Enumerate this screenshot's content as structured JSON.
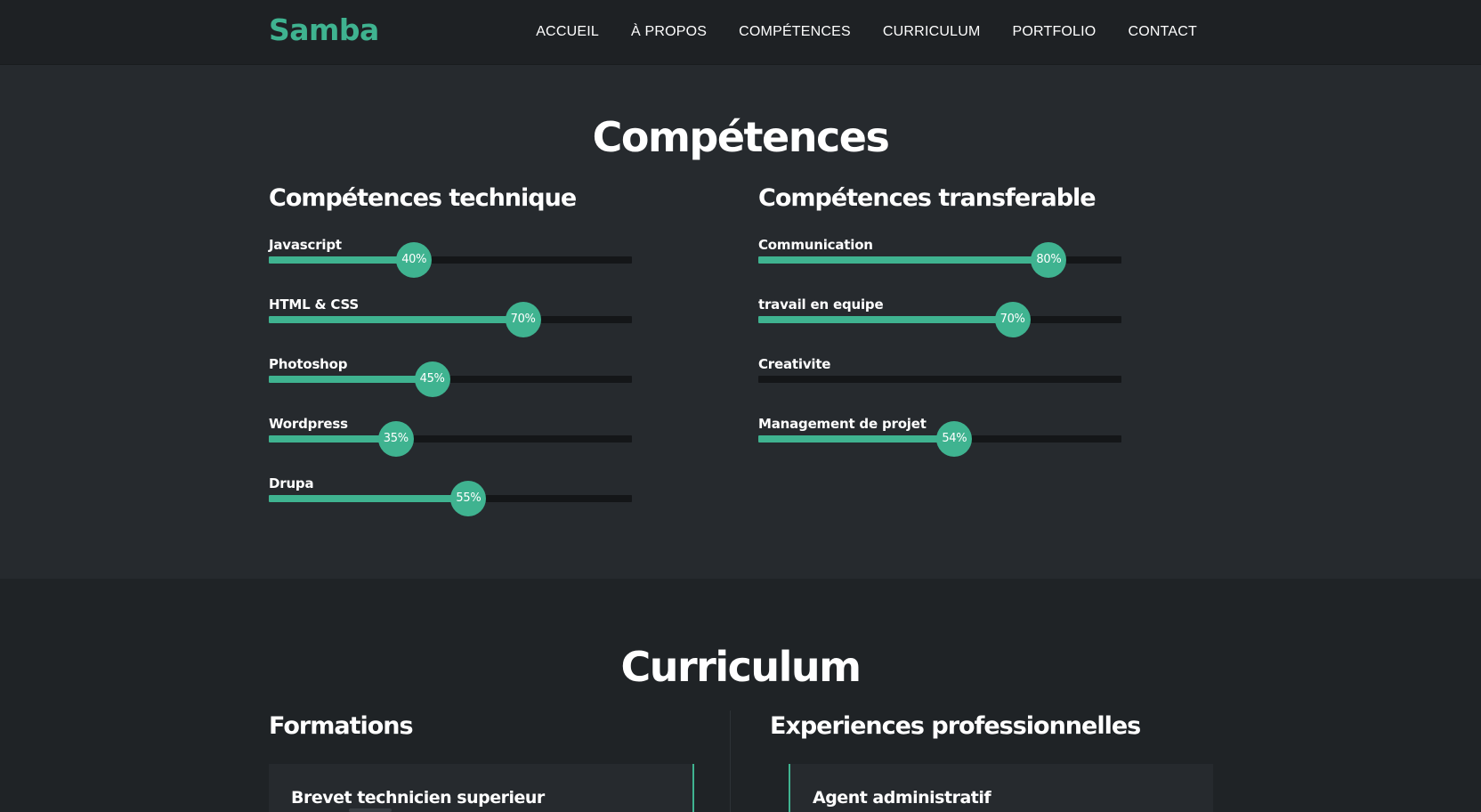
{
  "brand": {
    "name": "Samba",
    "accent_color": "#3fb390"
  },
  "nav": {
    "links": [
      "ACCUEIL",
      "À PROPOS",
      "COMPÉTENCES",
      "CURRICULUM",
      "PORTFOLIO",
      "CONTACT"
    ]
  },
  "skills_section": {
    "title": "Compétences",
    "technical": {
      "title": "Compétences technique",
      "items": [
        {
          "label": "Javascript",
          "percent": 40,
          "percent_text": "40%"
        },
        {
          "label": "HTML & CSS",
          "percent": 70,
          "percent_text": "70%"
        },
        {
          "label": "Photoshop",
          "percent": 45,
          "percent_text": "45%"
        },
        {
          "label": "Wordpress",
          "percent": 35,
          "percent_text": "35%"
        },
        {
          "label": "Drupa",
          "percent": 55,
          "percent_text": "55%"
        }
      ]
    },
    "transferable": {
      "title": "Compétences transferable",
      "items": [
        {
          "label": "Communication",
          "percent": 80,
          "percent_text": "80%"
        },
        {
          "label": "travail en equipe",
          "percent": 70,
          "percent_text": "70%"
        },
        {
          "label": "Creativite",
          "percent": 0,
          "percent_text": ""
        },
        {
          "label": "Management de projet",
          "percent": 54,
          "percent_text": "54%"
        }
      ]
    }
  },
  "curriculum_section": {
    "title": "Curriculum",
    "formations": {
      "title": "Formations",
      "first_item": "Brevet technicien superieur"
    },
    "experiences": {
      "title": "Experiences professionnelles",
      "first_item": "Agent administratif"
    }
  }
}
